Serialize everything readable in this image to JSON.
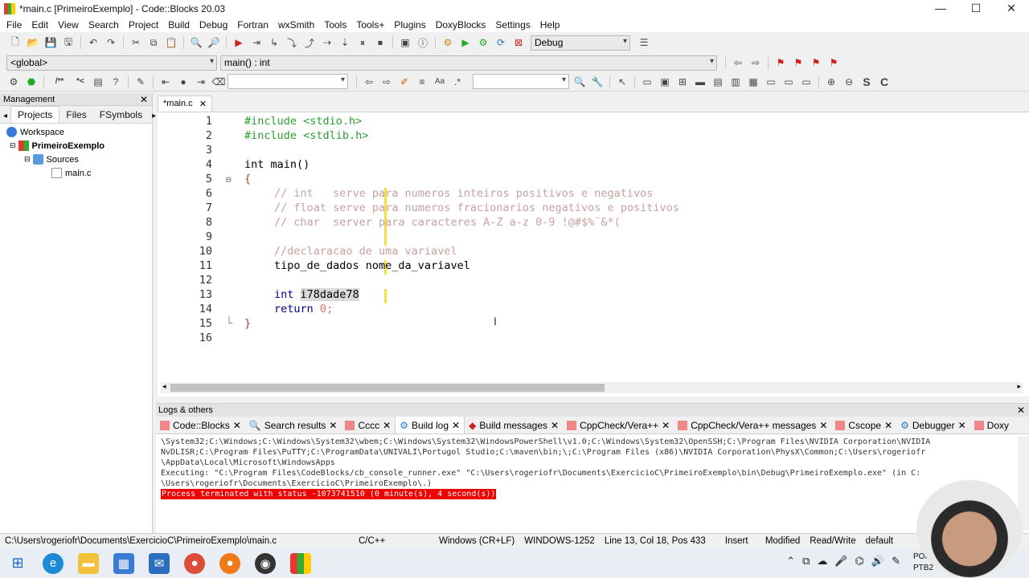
{
  "window": {
    "title": "*main.c [PrimeiroExemplo] - Code::Blocks 20.03",
    "controls": [
      "—",
      "☐",
      "✕"
    ]
  },
  "menu": [
    "File",
    "Edit",
    "View",
    "Search",
    "Project",
    "Build",
    "Debug",
    "Fortran",
    "wxSmith",
    "Tools",
    "Tools+",
    "Plugins",
    "DoxyBlocks",
    "Settings",
    "Help"
  ],
  "toolbar": {
    "build_target": "Debug",
    "scope": "<global>",
    "function": "main() : int"
  },
  "management": {
    "title": "Management",
    "tabs": [
      "Projects",
      "Files",
      "FSymbols"
    ],
    "active_tab": "Projects",
    "tree": {
      "workspace": "Workspace",
      "project": "PrimeiroExemplo",
      "folder": "Sources",
      "file": "main.c"
    }
  },
  "editor": {
    "tab": "*main.c",
    "lines": [
      "1",
      "2",
      "3",
      "4",
      "5",
      "6",
      "7",
      "8",
      "9",
      "10",
      "11",
      "12",
      "13",
      "14",
      "15",
      "16"
    ],
    "code": {
      "l1": "#include <stdio.h>",
      "l2": "#include <stdlib.h>",
      "l4": "int main()",
      "l5": "{",
      "l6": "// int   serve para numeros inteiros positivos e negativos",
      "l7": "// float serve para numeros fracionarios negativos e positivos",
      "l8": "// char  server para caracteres A-Z a-z 0-9 !@#$%¨&*(",
      "l10": "//declaracao de uma variavel",
      "l11": "tipo_de_dados nome_da_variavel",
      "l13_kw": "int",
      "l13_sel": "i78dade78",
      "l14_kw": "return",
      "l14_num": "0",
      "l14_end": ";",
      "l15": "}"
    }
  },
  "logs": {
    "title": "Logs & others",
    "tabs": [
      "Code::Blocks",
      "Search results",
      "Cccc",
      "Build log",
      "Build messages",
      "CppCheck/Vera++",
      "CppCheck/Vera++ messages",
      "Cscope",
      "Debugger",
      "Doxy"
    ],
    "active_tab": "Build log",
    "lines": [
      "\\System32;C:\\Windows;C:\\Windows\\System32\\wbem;C:\\Windows\\System32\\WindowsPowerShell\\v1.0;C:\\Windows\\System32\\OpenSSH;C:\\Program Files\\NVIDIA Corporation\\NVIDIA",
      "NvDLISR;C:\\Program Files\\PuTTY;C:\\ProgramData\\UNIVALI\\Portugol Studio;C:\\maven\\bin;\\;C:\\Program Files (x86)\\NVIDIA Corporation\\PhysX\\Common;C:\\Users\\rogeriofr",
      "\\AppData\\Local\\Microsoft\\WindowsApps",
      "Executing: \"C:\\Program Files\\CodeBlocks/cb_console_runner.exe\" \"C:\\Users\\rogeriofr\\Documents\\ExercicioC\\PrimeiroExemplo\\bin\\Debug\\PrimeiroExemplo.exe\"  (in C:",
      "\\Users\\rogeriofr\\Documents\\ExercicioC\\PrimeiroExemplo\\.)"
    ],
    "error": "Process terminated with status -1073741510 (0 minute(s), 4 second(s))"
  },
  "status": {
    "path": "C:\\Users\\rogeriofr\\Documents\\ExercicioC\\PrimeiroExemplo\\main.c",
    "lang": "C/C++",
    "eol": "Windows (CR+LF)",
    "encoding": "WINDOWS-1252",
    "position": "Line 13, Col 18, Pos 433",
    "mode": "Insert",
    "modified": "Modified",
    "access": "Read/Write",
    "profile": "default"
  },
  "taskbar": {
    "lang1": "POR",
    "lang2": "PTB2"
  }
}
